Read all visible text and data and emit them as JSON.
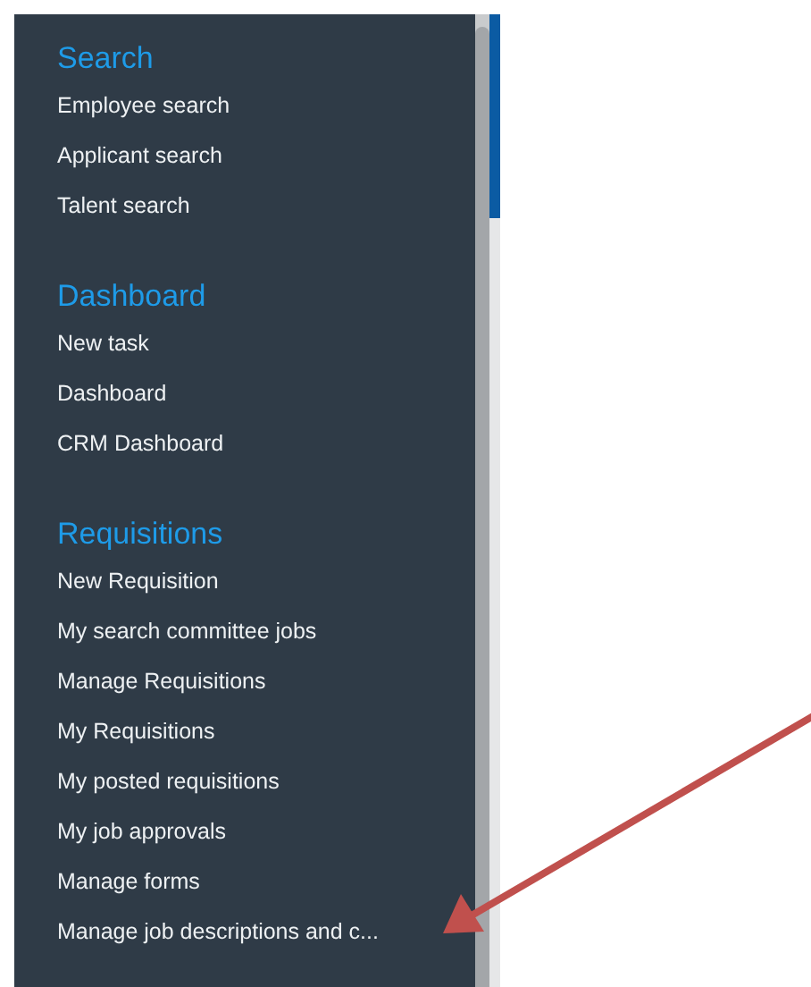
{
  "sidebar": {
    "sections": [
      {
        "heading": "Search",
        "items": [
          "Employee search",
          "Applicant search",
          "Talent search"
        ]
      },
      {
        "heading": "Dashboard",
        "items": [
          "New task",
          "Dashboard",
          "CRM Dashboard"
        ]
      },
      {
        "heading": "Requisitions",
        "items": [
          "New Requisition",
          "My search committee jobs",
          "Manage Requisitions",
          "My Requisitions",
          "My posted requisitions",
          "My job approvals",
          "Manage forms",
          "Manage job descriptions and c..."
        ]
      }
    ]
  }
}
